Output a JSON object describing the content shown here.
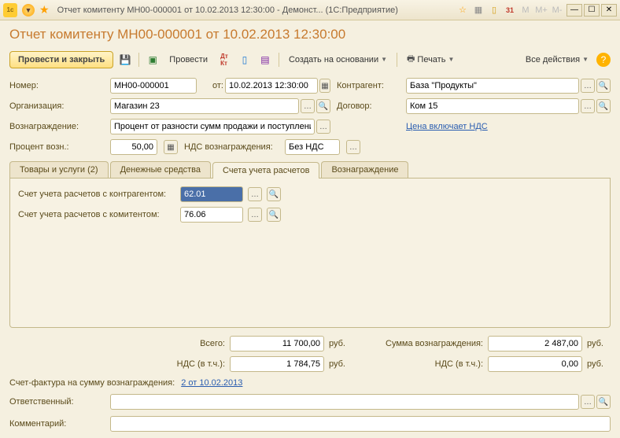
{
  "titlebar": {
    "title": "Отчет комитенту МН00-000001 от 10.02.2013 12:30:00 - Демонст...   (1С:Предприятие)",
    "m_labels": [
      "М",
      "М+",
      "М-"
    ]
  },
  "page_title": "Отчет комитенту МН00-000001 от 10.02.2013 12:30:00",
  "toolbar": {
    "main_btn": "Провести и закрыть",
    "post_label": "Провести",
    "create_based": "Создать на основании",
    "print": "Печать",
    "all_actions": "Все действия"
  },
  "fields": {
    "number_label": "Номер:",
    "number_value": "МН00-000001",
    "from_label": "от:",
    "date_value": "10.02.2013 12:30:00",
    "counterparty_label": "Контрагент:",
    "counterparty_value": "База \"Продукты\"",
    "org_label": "Организация:",
    "org_value": "Магазин 23",
    "contract_label": "Договор:",
    "contract_value": "Ком 15",
    "fee_label": "Вознаграждение:",
    "fee_value": "Процент от разности сумм продажи и поступления",
    "price_vat_link": "Цена включает НДС",
    "percent_label": "Процент возн.:",
    "percent_value": "50,00",
    "vat_fee_label": "НДС вознаграждения:",
    "vat_fee_value": "Без НДС"
  },
  "tabs": {
    "t1": "Товары и услуги (2)",
    "t2": "Денежные средства",
    "t3": "Счета учета расчетов",
    "t4": "Вознаграждение"
  },
  "accounts": {
    "a1_label": "Счет учета расчетов с контрагентом:",
    "a1_value": "62.01",
    "a2_label": "Счет учета расчетов с комитентом:",
    "a2_value": "76.06"
  },
  "totals": {
    "total_label": "Всего:",
    "total_value": "11 700,00",
    "rub": "руб.",
    "fee_sum_label": "Сумма вознаграждения:",
    "fee_sum_value": "2 487,00",
    "vat_label": "НДС (в т.ч.):",
    "vat_value": "1 784,75",
    "vat2_value": "0,00"
  },
  "footer": {
    "sf_label": "Счет-фактура на сумму вознаграждения:",
    "sf_link": "2 от 10.02.2013",
    "resp_label": "Ответственный:",
    "comment_label": "Комментарий:"
  }
}
